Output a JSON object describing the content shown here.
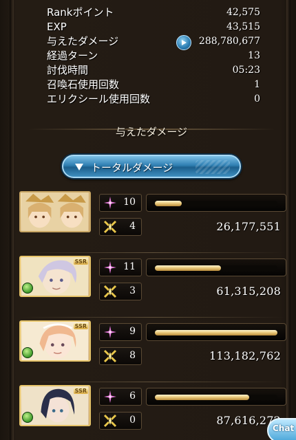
{
  "stats": [
    {
      "label": "Rankポイント",
      "value": "42,575"
    },
    {
      "label": "EXP",
      "value": "43,515"
    },
    {
      "label": "与えたダメージ",
      "value": "288,780,677"
    },
    {
      "label": "経過ターン",
      "value": "13"
    },
    {
      "label": "討伐時間",
      "value": "05:23"
    },
    {
      "label": "召喚石使用回数",
      "value": "1"
    },
    {
      "label": "エリクシール使用回数",
      "value": "0"
    }
  ],
  "section_title": "与えたダメージ",
  "total_button_label": "トータルダメージ",
  "players": [
    {
      "portrait": "twin-girls-portrait",
      "ssr": "",
      "ougi": "10",
      "count": "4",
      "damage": "26,177,551",
      "fill": 0.22
    },
    {
      "portrait": "white-hair-portrait",
      "ssr": "SSR",
      "ougi": "11",
      "count": "3",
      "damage": "61,315,208",
      "fill": 0.54
    },
    {
      "portrait": "blonde-girl-portrait",
      "ssr": "SSR",
      "ougi": "9",
      "count": "8",
      "damage": "113,182,762",
      "fill": 1.0
    },
    {
      "portrait": "dark-hair-portrait",
      "ssr": "SSR",
      "ougi": "6",
      "count": "0",
      "damage": "87,616,272",
      "fill": 0.77
    }
  ],
  "chat_label": "Chat",
  "colors": {
    "accent_blue": "#2f7fb2",
    "bar_gold": "#e8c678",
    "ougi_pink": "#e27ad8",
    "count_gold": "#e8c64a"
  }
}
